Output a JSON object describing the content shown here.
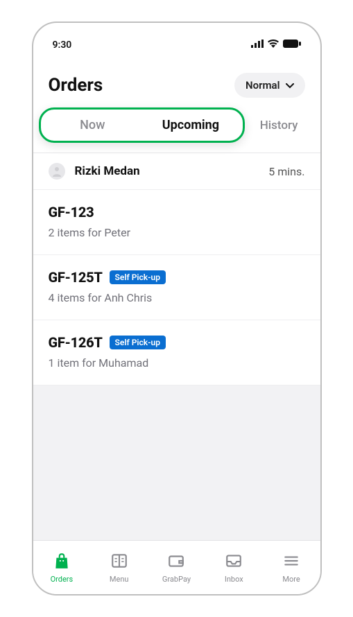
{
  "statusbar": {
    "time": "9:30"
  },
  "header": {
    "title": "Orders",
    "mode": "Normal"
  },
  "tabs": {
    "now": "Now",
    "upcoming": "Upcoming",
    "history": "History"
  },
  "driver": {
    "name": "Rizki Medan",
    "eta": "5 mins."
  },
  "orders": [
    {
      "id": "GF-123",
      "badge": null,
      "summary": "2 items for Peter"
    },
    {
      "id": "GF-125T",
      "badge": "Self Pick-up",
      "summary": "4 items for Anh Chris"
    },
    {
      "id": "GF-126T",
      "badge": "Self Pick-up",
      "summary": "1 item for Muhamad"
    }
  ],
  "nav": {
    "orders": "Orders",
    "menu": "Menu",
    "grabpay": "GrabPay",
    "inbox": "Inbox",
    "more": "More"
  }
}
